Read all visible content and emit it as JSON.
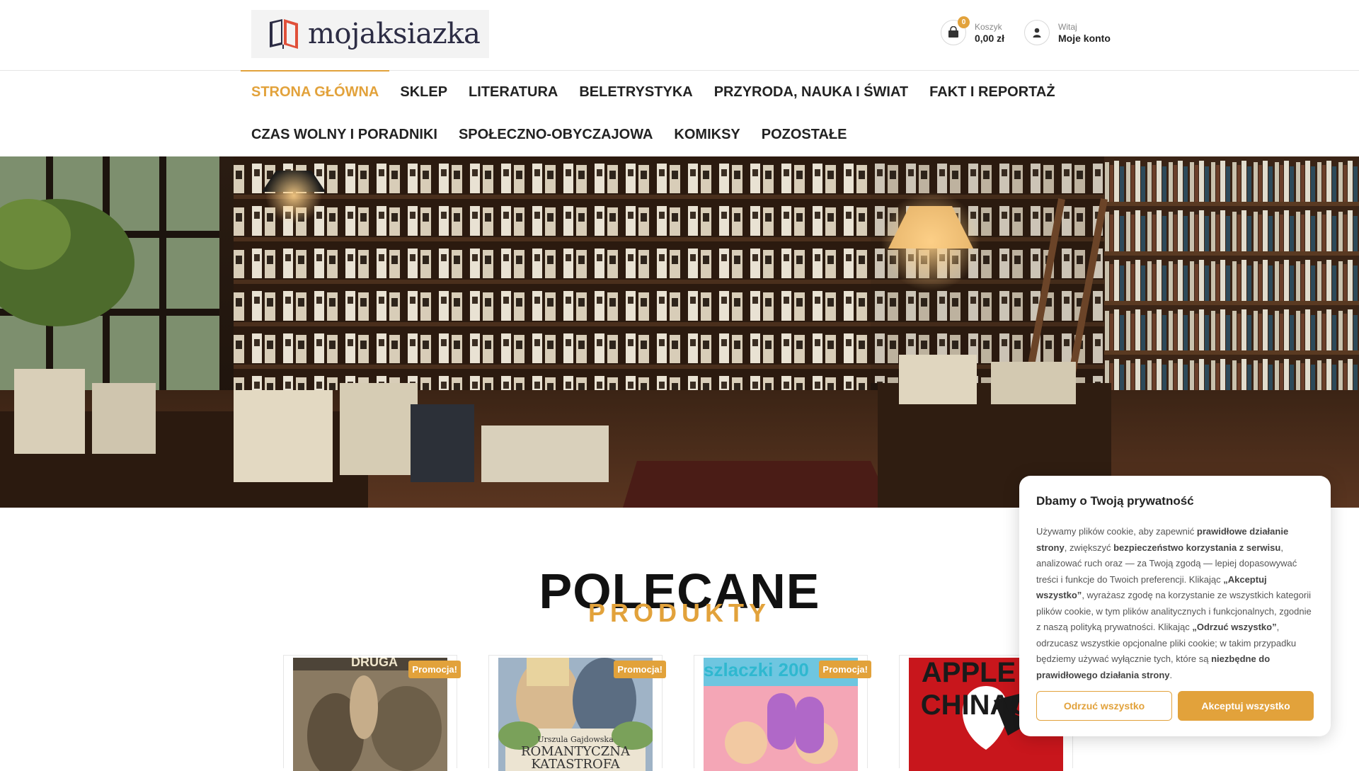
{
  "brand": {
    "logo_text": "mojaksiazka",
    "accent": "#e2a23b"
  },
  "header": {
    "cart": {
      "count": "0",
      "label": "Koszyk",
      "total": "0,00 zł"
    },
    "account": {
      "label": "Witaj",
      "link": "Moje konto"
    }
  },
  "nav": {
    "row1": [
      "Strona Główna",
      "Sklep",
      "Literatura",
      "Beletrystyka",
      "Przyroda, nauka i świat",
      "Fakt i reportaż"
    ],
    "row2": [
      "Czas wolny i poradniki",
      "Społeczno-obyczajowa",
      "Komiksy",
      "Pozostałe"
    ]
  },
  "section": {
    "title": "POLECANE",
    "subtitle": "PRODUKTY"
  },
  "products": [
    {
      "badge": "Promocja!",
      "cover_text": "DRUGA"
    },
    {
      "badge": "Promocja!",
      "author": "Urszula Gajdowska",
      "cover_text": "ROMANTYCZNA KATASTROFA"
    },
    {
      "badge": "Promocja!",
      "cover_text": "szlaczki 200"
    },
    {
      "cover_text": "APPLE W CHINACH"
    }
  ],
  "cookie": {
    "title": "Dbamy o Twoją prywatność",
    "t1": "Używamy plików cookie, aby zapewnić ",
    "b1": "prawidłowe działanie strony",
    "t2": ", zwiększyć ",
    "b2": "bezpieczeństwo korzystania z serwisu",
    "t3": ", analizować ruch oraz — za Twoją zgodą — lepiej dopasowywać treści i funkcje do Twoich preferencji. Klikając ",
    "b3": "„Akceptuj wszystko”",
    "t4": ", wyrażasz zgodę na korzystanie ze wszystkich kategorii plików cookie, w tym plików analitycznych i funkcjonalnych, zgodnie z naszą polityką prywatności. Klikając ",
    "b4": "„Odrzuć wszystko”",
    "t5": ", odrzucasz wszystkie opcjonalne pliki cookie; w takim przypadku będziemy używać wyłącznie tych, które są ",
    "b5": "niezbędne do prawidłowego działania strony",
    "t6": ".",
    "reject": "Odrzuć wszystko",
    "accept": "Akceptuj wszystko"
  }
}
